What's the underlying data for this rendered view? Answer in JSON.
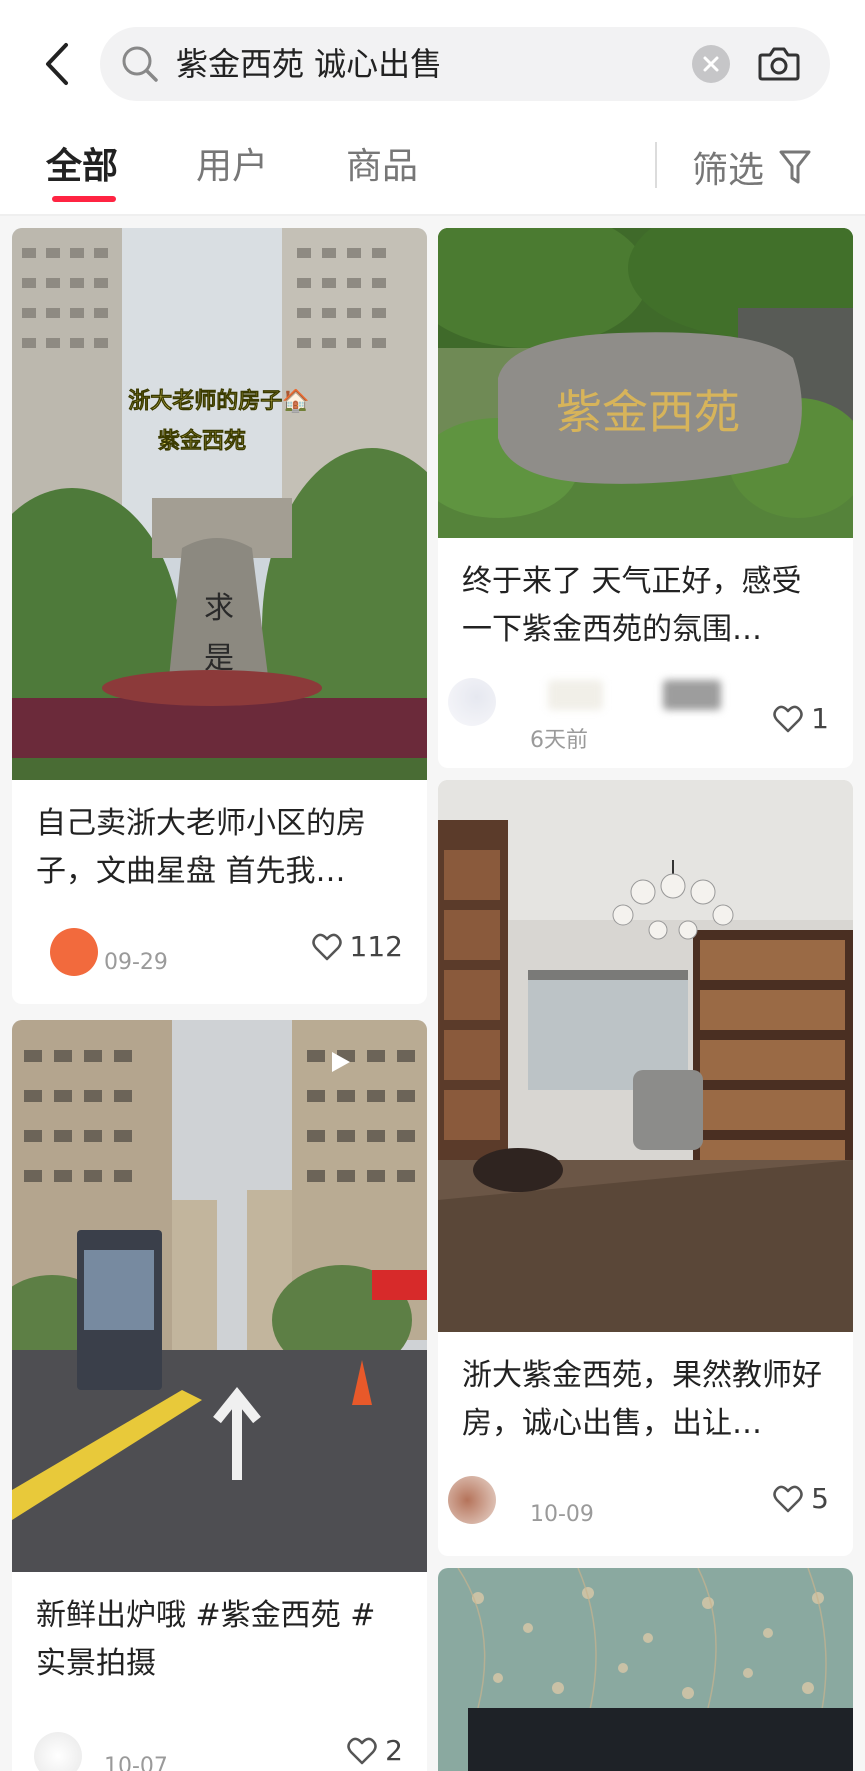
{
  "search": {
    "query": "紫金西苑 诚心出售"
  },
  "tabs": [
    {
      "label": "全部",
      "active": true
    },
    {
      "label": "用户",
      "active": false
    },
    {
      "label": "商品",
      "active": false
    }
  ],
  "filter_label": "筛选",
  "colors": {
    "accent": "#ff2442",
    "text_primary": "#222222",
    "text_secondary": "#9a9a9a",
    "feed_background": "#f6f6f6"
  },
  "icons": {
    "back": "chevron-left-icon",
    "search": "search-icon",
    "clear": "close-circle-icon",
    "camera": "camera-icon",
    "filter": "funnel-icon",
    "like": "heart-outline-icon",
    "video": "play-icon"
  },
  "cards": [
    {
      "title": "自己卖浙大老师小区的房子，文曲星盘 首先我…",
      "date": "09-29",
      "likes": "112",
      "image_overlay": [
        "浙大老师的房子🏠",
        "紫金西苑"
      ],
      "is_video": false
    },
    {
      "title": "终于来了 天气正好，感受一下紫金西苑的氛围…",
      "date": "6天前",
      "likes": "1",
      "image_overlay": [
        "紫金西苑"
      ],
      "is_video": false
    },
    {
      "title": "浙大紫金西苑，果然教师好房，诚心出售，出让…",
      "date": "10-09",
      "likes": "5",
      "is_video": false
    },
    {
      "title": "新鲜出炉哦 #紫金西苑 #实景拍摄",
      "date": "10-07",
      "likes": "2",
      "is_video": true
    },
    {
      "title": "",
      "date": "",
      "likes": "",
      "is_video": false
    }
  ]
}
